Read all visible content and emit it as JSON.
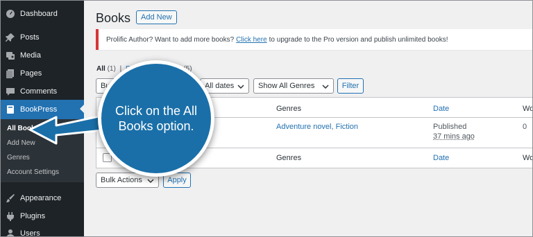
{
  "sidebar": {
    "items": [
      {
        "label": "Dashboard",
        "icon": "dashboard-icon"
      },
      {
        "label": "Posts",
        "icon": "pin-icon"
      },
      {
        "label": "Media",
        "icon": "media-icon"
      },
      {
        "label": "Pages",
        "icon": "pages-icon"
      },
      {
        "label": "Comments",
        "icon": "comment-icon"
      },
      {
        "label": "BookPress",
        "icon": "book-icon",
        "active": true
      },
      {
        "label": "Appearance",
        "icon": "brush-icon"
      },
      {
        "label": "Plugins",
        "icon": "plugin-icon"
      },
      {
        "label": "Users",
        "icon": "user-icon"
      }
    ],
    "submenu": [
      "All Books",
      "Add New",
      "Genres",
      "Account Settings"
    ]
  },
  "header": {
    "title": "Books",
    "add_new": "Add New"
  },
  "notice": {
    "before": "Prolific Author? Want to add more books?",
    "link": "Click here",
    "after": "to upgrade to the Pro version and publish unlimited books!"
  },
  "views": {
    "all_label": "All",
    "all_count": "(1)",
    "sep": "|",
    "other_prefix": "P",
    "other_suffix": "h",
    "other_count": "(5)"
  },
  "filters": {
    "bulk_partial": "Bu",
    "dates": "All dates",
    "genres": "Show All Genres",
    "filter_button": "Filter"
  },
  "table": {
    "columns": {
      "genres": "Genres",
      "date": "Date",
      "wo": "Wo"
    },
    "row": {
      "genres": "Adventure novel, Fiction",
      "status": "Published",
      "time": "37 mins ago",
      "wo": "0"
    }
  },
  "bottom": {
    "bulk_actions": "Bulk Actions",
    "apply": "Apply"
  },
  "callout": {
    "text": "Click on the All Books option."
  },
  "colors": {
    "sidebar": "#1d2327",
    "accent": "#2271b1",
    "callout": "#1a6fa8",
    "notice_border": "#d63638"
  }
}
